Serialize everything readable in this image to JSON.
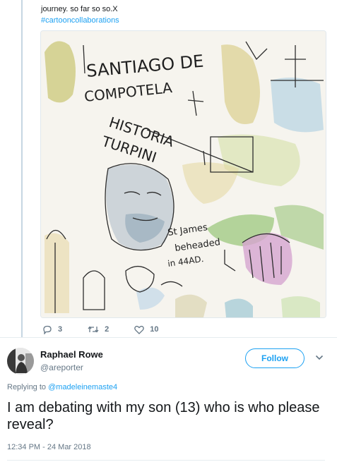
{
  "quoted_tweet": {
    "text_tail": "journey. so far so so.X",
    "hashtag": "#cartooncollaborations",
    "media": {
      "alt": "sketch",
      "lettering": [
        "SANTIAGO DE",
        "COMPOTELA",
        "HISTORIA",
        "TURPINI",
        "St James",
        "beheaded",
        "in 44AD."
      ]
    },
    "actions": {
      "reply_count": "3",
      "retweet_count": "2",
      "like_count": "10"
    },
    "colors": {
      "accent": "#1da1f2",
      "muted": "#657786",
      "thread_line": "#c6d6e2"
    }
  },
  "reply": {
    "author": {
      "display_name": "Raphael Rowe",
      "handle": "@areporter"
    },
    "follow_label": "Follow",
    "replying_prefix": "Replying to",
    "replying_to": "@madeleinemaste4",
    "text": "I am debating with my son (13) who is who please reveal?",
    "timestamp": "12:34 PM - 24 Mar 2018"
  },
  "icons": {
    "reply": "reply-icon",
    "retweet": "retweet-icon",
    "like": "heart-icon",
    "more": "chevron-down-icon"
  }
}
